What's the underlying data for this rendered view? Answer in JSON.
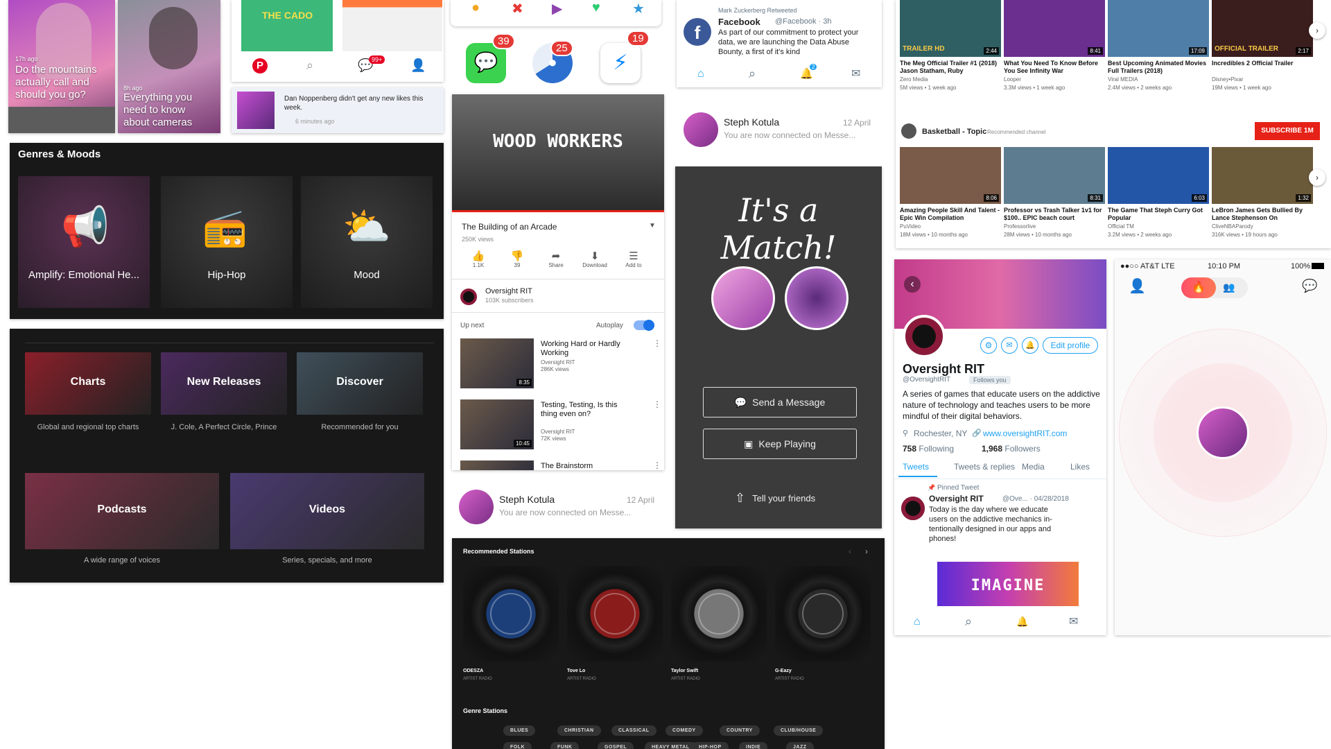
{
  "stories": [
    {
      "time": "17h ago",
      "caption": "Do the mountains actually call and should you go?"
    },
    {
      "time": "8h ago",
      "caption": "Everything you need to know about cameras"
    }
  ],
  "pinterest": {
    "cado_label": "THE CADO",
    "badge": "99+",
    "notif_text": "Dan Noppenberg didn't get any new likes this week.",
    "notif_time": "6 minutes ago"
  },
  "app_badges": {
    "messages": "39",
    "chrome": "25",
    "messenger": "19"
  },
  "twitter_feed": {
    "retweet_note": "Mark Zuckerberg Retweeted",
    "author": "Facebook",
    "handle": "@Facebook · 3h",
    "text": "As part of our commitment to protect your data, we are launching the Data Abuse Bounty, a first of it's kind",
    "notif_count": "2"
  },
  "connection_top": {
    "name": "Steph Kotula",
    "date": "12 April",
    "text": "You are now connected on Messe..."
  },
  "connection_bottom": {
    "name": "Steph Kotula",
    "date": "12 April",
    "text": "You are now connected on Messe..."
  },
  "youtube_top": {
    "rows": [
      [
        {
          "title": "The Meg Official Trailer #1 (2018) Jason Statham, Ruby",
          "channel": "Zero Media",
          "meta": "5M views • 1 week ago",
          "duration": "2:44",
          "overlay": "TRAILER HD",
          "color": "#2f5f63"
        },
        {
          "title": "What You Need To Know Before You See Infinity War",
          "channel": "Looper",
          "meta": "3.3M views • 1 week ago",
          "duration": "8:41",
          "overlay": "",
          "color": "#6a2f8f"
        },
        {
          "title": "Best Upcoming Animated Movies Full Trailers (2018)",
          "channel": "Viral MEDIA",
          "meta": "2.4M views • 2 weeks ago",
          "duration": "17:09",
          "overlay": "",
          "color": "#4f7fa8"
        },
        {
          "title": "Incredibles 2 Official Trailer",
          "channel": "Disney•Pixar",
          "meta": "19M views • 1 week ago",
          "duration": "2:17",
          "overlay": "OFFICIAL TRAILER",
          "color": "#3a1d1d"
        }
      ],
      [
        {
          "title": "Amazing People Skill And Talent - Epic Win Compilation",
          "channel": "PuVideo",
          "meta": "18M views • 10 months ago",
          "duration": "8:06",
          "overlay": "",
          "color": "#7a5a48"
        },
        {
          "title": "Professor vs Trash Talker 1v1 for $100.. EPIC beach court",
          "channel": "Professorlive",
          "meta": "28M views • 10 months ago",
          "duration": "8:31",
          "overlay": "",
          "color": "#5d7c8f"
        },
        {
          "title": "The Game That Steph Curry Got Popular",
          "channel": "Official TM",
          "meta": "3.2M views • 2 weeks ago",
          "duration": "6:03",
          "overlay": "",
          "color": "#2456a8"
        },
        {
          "title": "LeBron James Gets Bullied By Lance Stephenson On",
          "channel": "CliveNBAParody",
          "meta": "316K views • 19 hours ago",
          "duration": "1:32",
          "overlay": "",
          "color": "#6b5a3a"
        }
      ]
    ],
    "channel_name": "Basketball - Topic",
    "channel_note": "Recommended channel",
    "subscribe": "SUBSCRIBE 1M"
  },
  "genres": {
    "title": "Genres & Moods",
    "tiles": [
      {
        "label": "Amplify: Emotional He...",
        "icon": "megaphone-icon"
      },
      {
        "label": "Hip-Hop",
        "icon": "boombox-icon"
      },
      {
        "label": "Mood",
        "icon": "weather-icon"
      }
    ]
  },
  "browse": {
    "row1": [
      {
        "label": "Charts",
        "sub": "Global and regional top charts",
        "color": "#8b1f2a"
      },
      {
        "label": "New Releases",
        "sub": "J. Cole, A Perfect Circle, Prince",
        "color": "#4b2a5e"
      },
      {
        "label": "Discover",
        "sub": "Recommended for you",
        "color": "#3f4f5a"
      }
    ],
    "row2": [
      {
        "label": "Podcasts",
        "sub": "A wide range of voices",
        "color": "#7a3045"
      },
      {
        "label": "Videos",
        "sub": "Series, specials, and more",
        "color": "#4a3a70"
      }
    ]
  },
  "yt_watch": {
    "video_title": "WOOD WORKERS",
    "title": "The Building of an Arcade",
    "views": "250K views",
    "actions": [
      {
        "icon": "thumbs-up-icon",
        "label": "1.1K"
      },
      {
        "icon": "thumbs-down-icon",
        "label": "39"
      },
      {
        "icon": "share-icon",
        "label": "Share"
      },
      {
        "icon": "download-icon",
        "label": "Download"
      },
      {
        "icon": "add-to-icon",
        "label": "Add to"
      }
    ],
    "channel": "Oversight RIT",
    "subs": "103K subscribers",
    "up_next": "Up next",
    "autoplay": "Autoplay",
    "next": [
      {
        "title": "Working Hard or Hardly Working",
        "channel": "Oversight RIT",
        "views": "286K views",
        "duration": "8:35"
      },
      {
        "title": "Testing, Testing, Is this thing even on?",
        "channel": "Oversight RIT",
        "views": "72K views",
        "duration": "10:45"
      },
      {
        "title": "The Brainstorm",
        "channel": "",
        "views": "",
        "duration": ""
      }
    ]
  },
  "match": {
    "title": "It's a Match!",
    "send": "Send a Message",
    "keep": "Keep Playing",
    "tell": "Tell your friends"
  },
  "stations": {
    "title": "Recommended Stations",
    "items": [
      {
        "name": "ODESZA",
        "sub": "ARTIST RADIO",
        "color": "#1c3f7a"
      },
      {
        "name": "Tove Lo",
        "sub": "ARTIST RADIO",
        "color": "#8a1c1c"
      },
      {
        "name": "Taylor Swift",
        "sub": "ARTIST RADIO",
        "color": "#777777"
      },
      {
        "name": "G-Eazy",
        "sub": "ARTIST RADIO",
        "color": "#2a2a2a"
      }
    ],
    "genre_title": "Genre Stations",
    "genres_row1": [
      "BLUES",
      "CHRISTIAN",
      "CLASSICAL",
      "COMEDY",
      "COUNTRY",
      "CLUB/HOUSE"
    ],
    "genres_row2": [
      "FOLK",
      "FUNK",
      "GOSPEL",
      "HEAVY METAL",
      "HIP-HOP",
      "INDIE",
      "JAZZ"
    ]
  },
  "profile": {
    "name": "Oversight RIT",
    "handle": "@OversightRIT",
    "follows_you": "Follows you",
    "edit": "Edit profile",
    "bio": "A series of games that educate users on the addictive nature of technology and teaches users to be more mindful of their digital behaviors.",
    "location": "Rochester, NY",
    "url": "www.oversightRIT.com",
    "following_count": "758",
    "following_label": "Following",
    "followers_count": "1,968",
    "followers_label": "Followers",
    "tabs": [
      "Tweets",
      "Tweets & replies",
      "Media",
      "Likes"
    ],
    "pinned": "Pinned Tweet",
    "tweet_author": "Oversight RIT",
    "tweet_handle": "@Ove... · 04/28/2018",
    "tweet_text": "Today is the day where we educate users on the addictive mechanics in-tentionally designed in our apps and phones!",
    "image_text": "IMAGINE"
  },
  "tinder": {
    "carrier": "●●○○ AT&T LTE",
    "time": "10:10 PM",
    "battery": "100%"
  },
  "colors": {
    "spotify_dark": "#181818",
    "youtube_red": "#e62117",
    "twitter_blue": "#1da1f2",
    "tinder_pink": "#fd5068",
    "match_bg": "#3b3b3b"
  }
}
